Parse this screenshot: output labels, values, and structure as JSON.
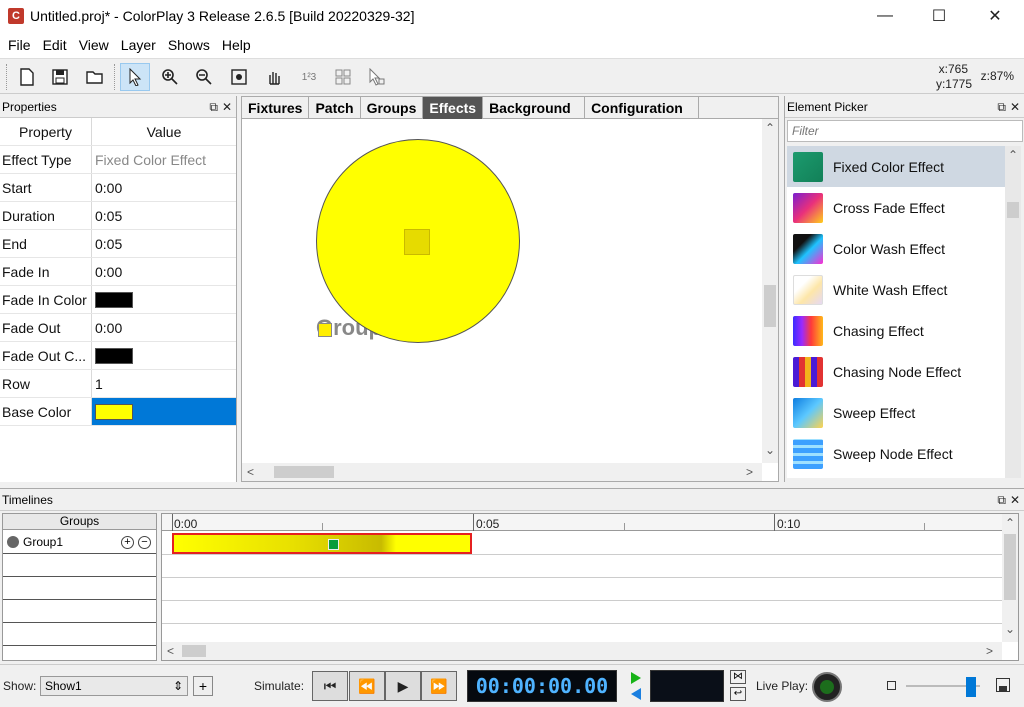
{
  "window": {
    "title": "Untitled.proj* - ColorPlay 3 Release 2.6.5 [Build 20220329-32]"
  },
  "menu": [
    "File",
    "Edit",
    "View",
    "Layer",
    "Shows",
    "Help"
  ],
  "toolbar": {
    "coord_x": "x:765",
    "coord_y": "y:1775",
    "zoom": "z:87%"
  },
  "properties": {
    "title": "Properties",
    "col_property": "Property",
    "col_value": "Value",
    "rows": [
      {
        "name": "Effect Type",
        "value": "Fixed Color Effect"
      },
      {
        "name": "Start",
        "value": "0:00"
      },
      {
        "name": "Duration",
        "value": "0:05"
      },
      {
        "name": "End",
        "value": "0:05"
      },
      {
        "name": "Fade In",
        "value": "0:00"
      },
      {
        "name": "Fade In Color",
        "value": "",
        "color": "#000000"
      },
      {
        "name": "Fade Out",
        "value": "0:00"
      },
      {
        "name": "Fade Out C...",
        "value": "",
        "color": "#000000"
      },
      {
        "name": "Row",
        "value": "1"
      },
      {
        "name": "Base Color",
        "value": "",
        "color": "#ffff00"
      }
    ]
  },
  "tabs": [
    "Fixtures",
    "Patch",
    "Groups",
    "Effects",
    "Background",
    "Configuration"
  ],
  "active_tab": "Effects",
  "canvas": {
    "group_label": "Group"
  },
  "picker": {
    "title": "Element Picker",
    "filter_placeholder": "Filter",
    "items": [
      {
        "label": "Fixed Color Effect",
        "icon": "fixed-color-icon"
      },
      {
        "label": "Cross Fade Effect",
        "icon": "cross-fade-icon"
      },
      {
        "label": "Color Wash Effect",
        "icon": "color-wash-icon"
      },
      {
        "label": "White Wash Effect",
        "icon": "white-wash-icon"
      },
      {
        "label": "Chasing Effect",
        "icon": "chasing-icon"
      },
      {
        "label": "Chasing Node Effect",
        "icon": "chasing-node-icon"
      },
      {
        "label": "Sweep Effect",
        "icon": "sweep-icon"
      },
      {
        "label": "Sweep Node Effect",
        "icon": "sweep-node-icon"
      }
    ]
  },
  "timelines": {
    "title": "Timelines",
    "groups_header": "Groups",
    "group_name": "Group1",
    "ticks": [
      "0:00",
      "0:05",
      "0:10"
    ]
  },
  "bottom": {
    "show_label": "Show:",
    "show_value": "Show1",
    "simulate_label": "Simulate:",
    "timecode": "00:00:00.00",
    "live_play_label": "Live Play:"
  },
  "colors": {
    "accent": "#0078d7",
    "base_color": "#ffff00",
    "active_tab": "#555555",
    "effect_border": "#e52020"
  }
}
